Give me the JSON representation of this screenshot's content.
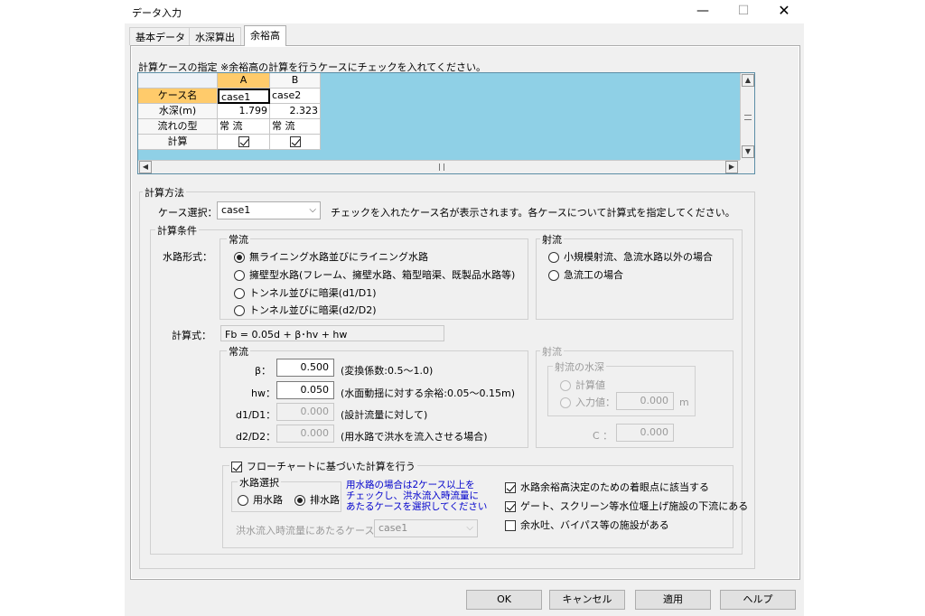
{
  "window": {
    "title": "データ入力",
    "minimize": "—",
    "maximize": "☐",
    "close": "✕"
  },
  "tabs": [
    {
      "label": "基本データ"
    },
    {
      "label": "水深算出"
    },
    {
      "label": "余裕高"
    }
  ],
  "case_section": {
    "label": "計算ケースの指定 ※余裕高の計算を行うケースにチェックを入れてください。",
    "columns": [
      "A",
      "B"
    ],
    "row_headers": [
      "ケース名",
      "水深(m)",
      "流れの型",
      "計算"
    ],
    "cells": [
      [
        "case1",
        "case2"
      ],
      [
        "1.799",
        "2.323"
      ],
      [
        "常 流",
        "常 流"
      ],
      [
        true,
        true
      ]
    ]
  },
  "method": {
    "group_label": "計算方法",
    "case_select_label": "ケース選択：",
    "case_select_value": "case1",
    "case_select_hint": "チェックを入れたケース名が表示されます。各ケースについて計算式を指定してください。",
    "conditions_label": "計算条件",
    "joryu": {
      "group_label": "常流",
      "channel_label": "水路形式：",
      "options": [
        {
          "label": "無ライニング水路並びにライニング水路",
          "selected": true
        },
        {
          "label": "擁壁型水路(フレーム、擁壁水路、箱型暗渠、既製品水路等)",
          "selected": false
        },
        {
          "label": "トンネル並びに暗渠(d1/D1)",
          "selected": false
        },
        {
          "label": "トンネル並びに暗渠(d2/D2)",
          "selected": false
        }
      ]
    },
    "shaeryu": {
      "group_label": "射流",
      "options": [
        {
          "label": "小規模射流、急流水路以外の場合",
          "selected": false
        },
        {
          "label": "急流工の場合",
          "selected": false
        }
      ]
    },
    "formula_label": "計算式：",
    "formula": "Fb = 0.05d + β･hv + hw",
    "params_joryu": {
      "group_label": "常流",
      "rows": [
        {
          "label": "β：",
          "value": "0.500",
          "note": "(変換係数:0.5〜1.0)"
        },
        {
          "label": "hw：",
          "value": "0.050",
          "note": "(水面動揺に対する余裕:0.05〜0.15m)"
        },
        {
          "label": "d1/D1：",
          "value": "0.000",
          "note": "(設計流量に対して)"
        },
        {
          "label": "d2/D2：",
          "value": "0.000",
          "note": "(用水路で洪水を流入させる場合)"
        }
      ]
    },
    "params_shaeryu": {
      "group_label": "射流",
      "depth_group_label": "射流の水深",
      "calc_value_label": "計算値",
      "input_value_label": "入力値：",
      "input_value": "0.000",
      "input_unit": "m",
      "c_label": "C ：",
      "c_value": "0.000"
    },
    "flowchart": {
      "checkbox_label": "フローチャートに基づいた計算を行う",
      "checked": true,
      "channel_group_label": "水路選択",
      "channel_options": [
        {
          "label": "用水路",
          "selected": false
        },
        {
          "label": "排水路",
          "selected": true
        }
      ],
      "note": "用水路の場合は2ケース以上を\nチェックし、洪水流入時流量に\nあたるケースを選択してください",
      "flood_case_label": "洪水流入時流量にあたるケース：",
      "flood_case_value": "case1",
      "checks": [
        {
          "label": "水路余裕高決定のための着眼点に該当する",
          "checked": true
        },
        {
          "label": "ゲート、スクリーン等水位堰上げ施設の下流にある",
          "checked": true
        },
        {
          "label": "余水吐、バイパス等の施設がある",
          "checked": false
        }
      ]
    }
  },
  "buttons": {
    "ok": "OK",
    "cancel": "キャンセル",
    "apply": "適用",
    "help": "ヘルプ"
  }
}
